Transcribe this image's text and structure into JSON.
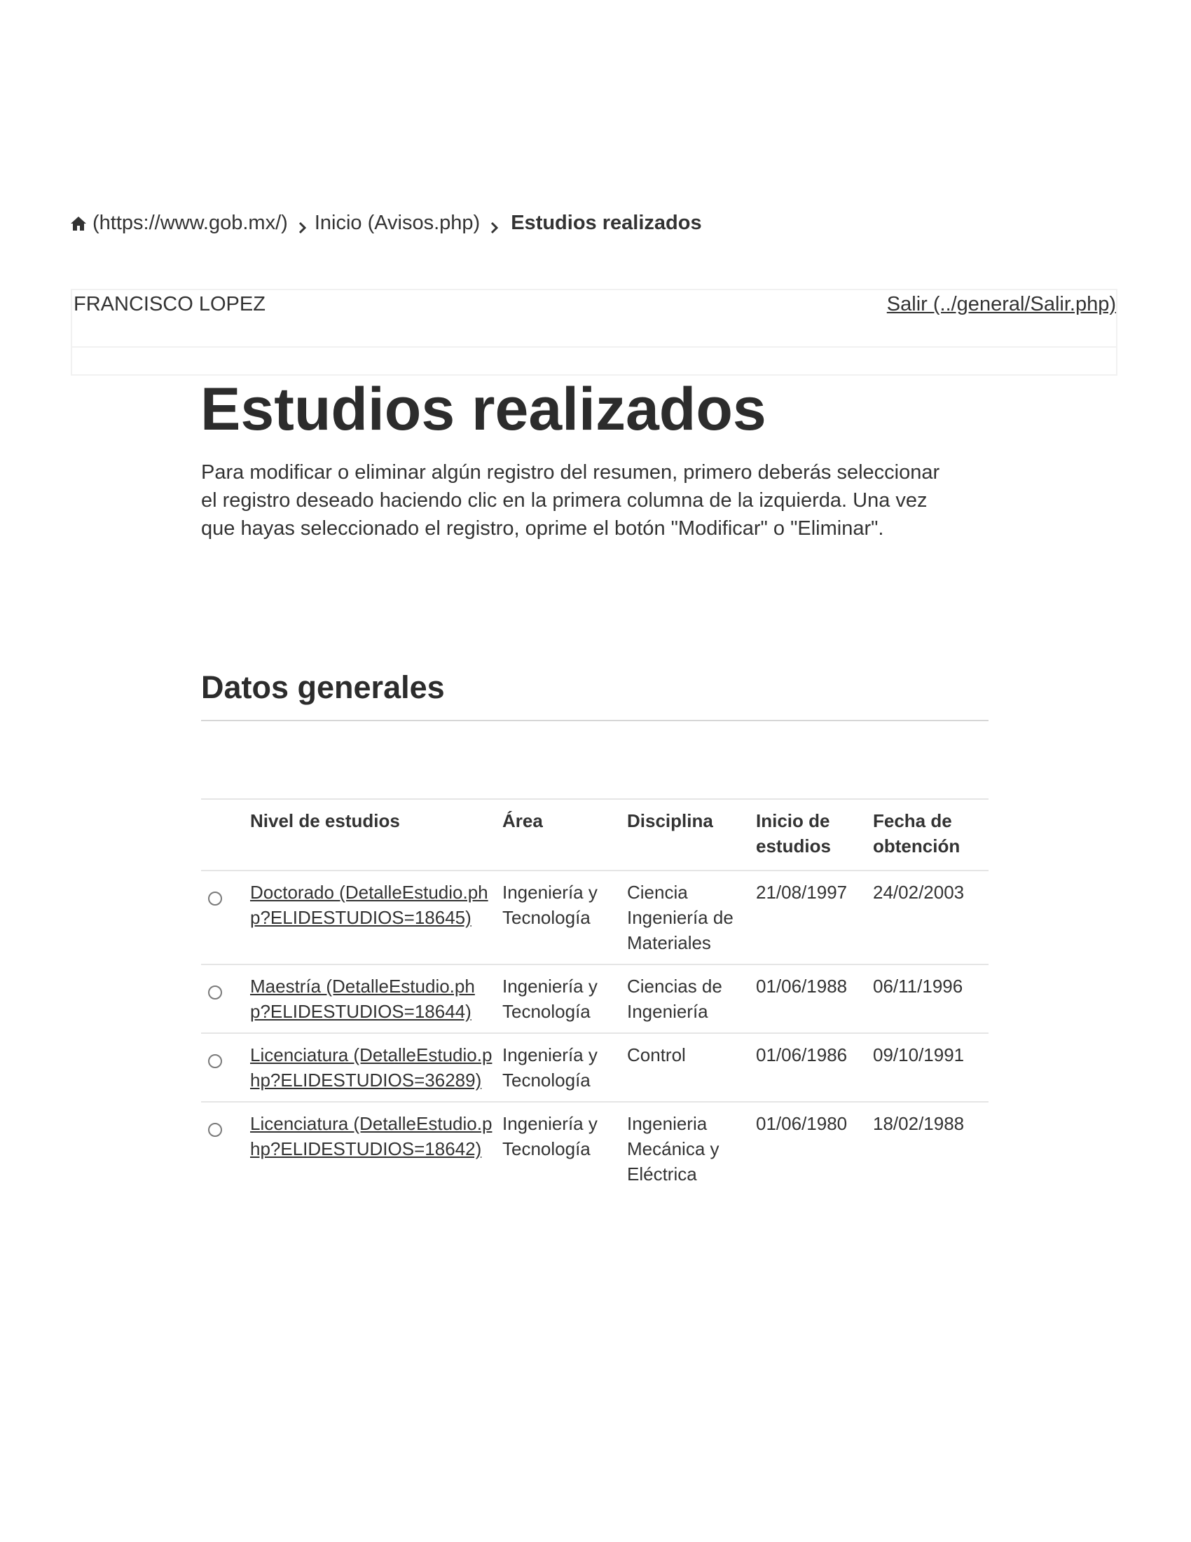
{
  "breadcrumb": {
    "home_icon": "home-icon",
    "home_text": "(https://www.gob.mx/)",
    "inicio_text": "Inicio (Avisos.php)",
    "current_text": "Estudios realizados",
    "separator_icon": "chevron-right-icon"
  },
  "userbar": {
    "user_name": "FRANCISCO LOPEZ",
    "logout_label": "Salir (../general/Salir.php)"
  },
  "page": {
    "title": "Estudios realizados",
    "intro": "Para modificar o eliminar algún registro del resumen, primero deberás seleccionar el registro deseado haciendo clic en la primera columna de la izquierda. Una vez que hayas seleccionado el registro, oprime el botón \"Modificar\" o \"Eliminar\".",
    "section_title": "Datos generales"
  },
  "table": {
    "headers": {
      "nivel": "Nivel de estudios",
      "area": "Área",
      "disciplina": "Disciplina",
      "inicio": "Inicio de estudios",
      "fecha": "Fecha de obtención"
    },
    "rows": [
      {
        "nivel_link": "Doctorado (DetalleEstudio.php?ELIDESTUDIOS=18645)",
        "area": "Ingeniería y Tecnología",
        "disciplina": "Ciencia Ingeniería de Materiales",
        "inicio": "21/08/1997",
        "fecha": "24/02/2003"
      },
      {
        "nivel_link": "Maestría (DetalleEstudio.php?ELIDESTUDIOS=18644)",
        "area": "Ingeniería y Tecnología",
        "disciplina": "Ciencias de Ingeniería",
        "inicio": "01/06/1988",
        "fecha": "06/11/1996"
      },
      {
        "nivel_link": "Licenciatura (DetalleEstudio.php?ELIDESTUDIOS=36289)",
        "area": "Ingeniería y Tecnología",
        "disciplina": "Control",
        "inicio": "01/06/1986",
        "fecha": "09/10/1991"
      },
      {
        "nivel_link": "Licenciatura (DetalleEstudio.php?ELIDESTUDIOS=18642)",
        "area": "Ingeniería y Tecnología",
        "disciplina": "Ingenieria Mecánica y Eléctrica",
        "inicio": "01/06/1980",
        "fecha": "18/02/1988"
      }
    ]
  }
}
